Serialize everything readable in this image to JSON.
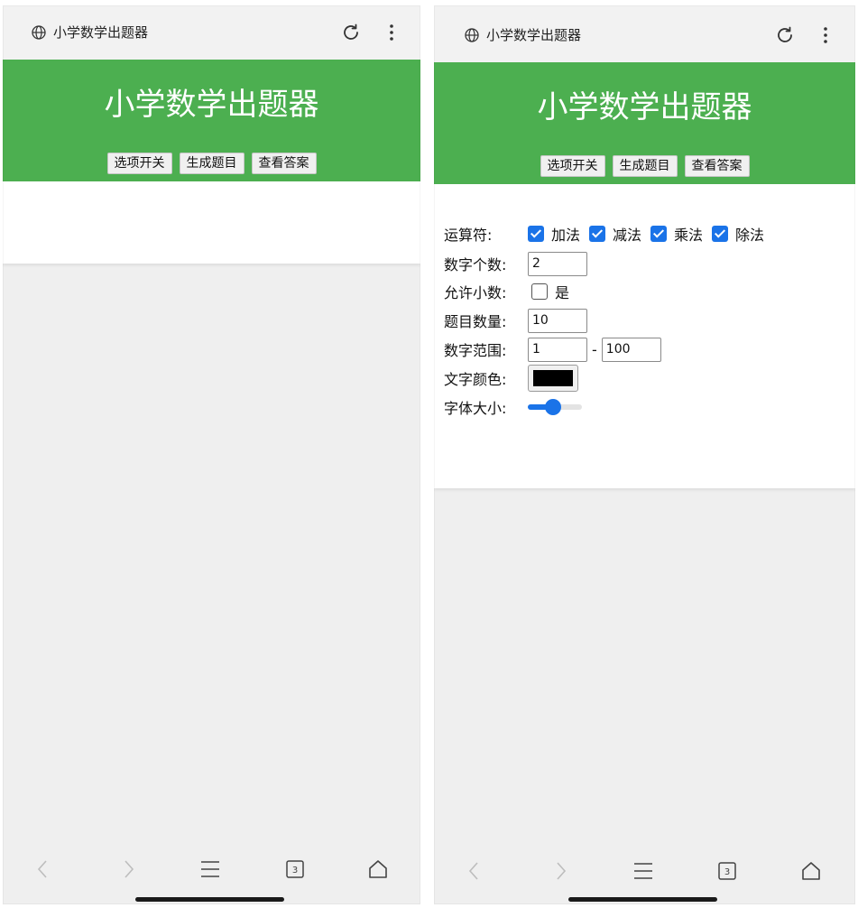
{
  "browser": {
    "page_title": "小学数学出题器"
  },
  "app": {
    "title": "小学数学出题器",
    "buttons": {
      "options": "选项开关",
      "generate": "生成题目",
      "answers": "查看答案"
    },
    "header_color": "#4caf50"
  },
  "options": {
    "operators": {
      "label": "运算符:",
      "items": [
        {
          "label": "加法",
          "checked": true
        },
        {
          "label": "减法",
          "checked": true
        },
        {
          "label": "乘法",
          "checked": true
        },
        {
          "label": "除法",
          "checked": true
        }
      ]
    },
    "number_count": {
      "label": "数字个数:",
      "value": "2"
    },
    "allow_decimal": {
      "label": "允许小数:",
      "option_label": "是",
      "checked": false
    },
    "question_count": {
      "label": "题目数量:",
      "value": "10"
    },
    "number_range": {
      "label": "数字范围:",
      "min": "1",
      "separator": "-",
      "max": "100"
    },
    "text_color": {
      "label": "文字颜色:",
      "value": "#000000"
    },
    "font_size": {
      "label": "字体大小:",
      "level": 0.45
    }
  },
  "system_nav": {
    "tab_count": "3",
    "icons": [
      "back-icon",
      "forward-icon",
      "menu-lines-icon",
      "tabs-icon",
      "home-icon"
    ]
  }
}
